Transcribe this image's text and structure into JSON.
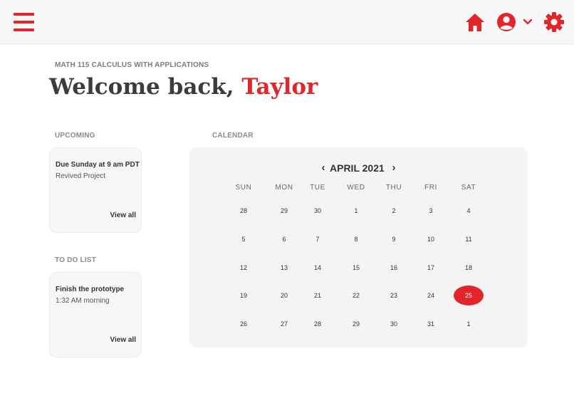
{
  "colors": {
    "accent": "#e2242b",
    "topbar_bg": "#f7f7f7",
    "card_bg": "#f7f7f7",
    "calendar_bg": "#f4f4f4",
    "text": "#333333",
    "muted": "#8a8a8a"
  },
  "topbar": {
    "menu_icon": "hamburger-menu-icon",
    "home_icon": "home-icon",
    "account_icon": "user-circle-icon",
    "account_dropdown_icon": "chevron-down-icon",
    "settings_icon": "gear-icon"
  },
  "header": {
    "course": "MATH 115 CALCULUS WITH APPLICATIONS",
    "welcome_prefix": "Welcome back,",
    "user_name": "Taylor"
  },
  "upcoming": {
    "label": "UPCOMING",
    "title": "Due Sunday at 9 am PDT",
    "subtitle": "Revived Project",
    "view_all": "View all"
  },
  "todo": {
    "label": "TO DO LIST",
    "title": "Finish the prototype",
    "subtitle": "1:32 AM morning",
    "view_all": "View all"
  },
  "calendar": {
    "label": "CALENDAR",
    "month": "APRIL 2021",
    "prev_icon": "chevron-left-icon",
    "next_icon": "chevron-right-icon",
    "weekdays": [
      "SUN",
      "MON",
      "TUE",
      "WED",
      "THU",
      "FRI",
      "SAT"
    ],
    "weeks": [
      [
        "28",
        "29",
        "30",
        "1",
        "2",
        "3",
        "4"
      ],
      [
        "5",
        "6",
        "7",
        "8",
        "9",
        "10",
        "11"
      ],
      [
        "12",
        "13",
        "14",
        "15",
        "16",
        "17",
        "18"
      ],
      [
        "19",
        "20",
        "21",
        "22",
        "23",
        "24",
        "25"
      ],
      [
        "26",
        "27",
        "28",
        "29",
        "30",
        "31",
        "1"
      ]
    ],
    "selected_day": "25"
  }
}
